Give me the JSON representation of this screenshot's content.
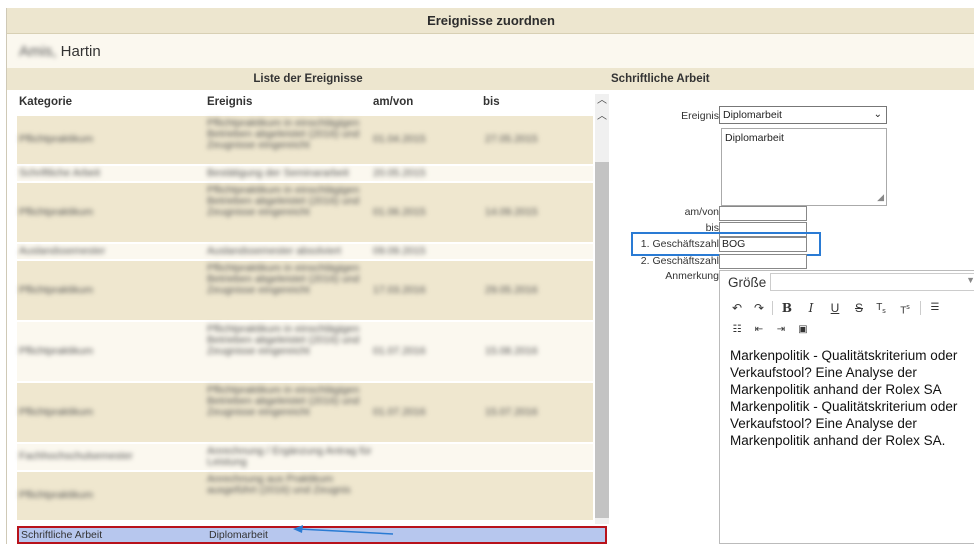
{
  "window": {
    "title": "Ereignisse zuordnen"
  },
  "person": {
    "name_blurred": "Amis, ",
    "name_visible": "Hartin"
  },
  "left_panel": {
    "title": "Liste der Ereignisse",
    "columns": [
      "Kategorie",
      "Ereignis",
      "am/von",
      "bis"
    ],
    "rows": [
      {
        "kategorie": "Pflichtpraktikum",
        "ereignis": "Pflichtpraktikum in einschlägigen Betrieben abgeleistet (2016) und Zeugnisse eingereicht",
        "von": "01.04.2015",
        "bis": "27.05.2015",
        "lines": 4,
        "style": "bg"
      },
      {
        "kategorie": "Schriftliche Arbeit",
        "ereignis": "Bestätigung der Seminararbeit",
        "von": "20.05.2015",
        "bis": "",
        "lines": 1,
        "style": "alt"
      },
      {
        "kategorie": "Pflichtpraktikum",
        "ereignis": "Pflichtpraktikum in einschlägigen Betrieben abgeleistet (2016) und Zeugnisse eingereicht",
        "von": "01.06.2015",
        "bis": "14.09.2015",
        "lines": 5,
        "style": "bg"
      },
      {
        "kategorie": "Auslandssemester",
        "ereignis": "Auslandssemester absolviert",
        "von": "09.09.2015",
        "bis": "",
        "lines": 1,
        "style": "alt"
      },
      {
        "kategorie": "Pflichtpraktikum",
        "ereignis": "Pflichtpraktikum in einschlägigen Betrieben abgeleistet (2016) und Zeugnisse eingereicht",
        "von": "17.03.2016",
        "bis": "29.05.2016",
        "lines": 5,
        "style": "bg"
      },
      {
        "kategorie": "Pflichtpraktikum",
        "ereignis": "Pflichtpraktikum in einschlägigen Betrieben abgeleistet (2016) und Zeugnisse eingereicht",
        "von": "01.07.2016",
        "bis": "15.08.2016",
        "lines": 5,
        "style": "alt"
      },
      {
        "kategorie": "Pflichtpraktikum",
        "ereignis": "Pflichtpraktikum in einschlägigen Betrieben abgeleistet (2016) und Zeugnisse eingereicht",
        "von": "01.07.2016",
        "bis": "15.07.2016",
        "lines": 5,
        "style": "bg"
      },
      {
        "kategorie": "Fachhochschulsemester",
        "ereignis": "Anrechnung / Ergänzung Antrag für Leistung",
        "von": "",
        "bis": "",
        "lines": 2,
        "style": "alt"
      },
      {
        "kategorie": "Pflichtpraktikum",
        "ereignis": "Anrechnung aus Praktikum ausgeführt (2016) und Zeugnis",
        "von": "",
        "bis": "",
        "lines": 4,
        "style": "bg"
      }
    ],
    "selected_row": {
      "kategorie": "Schriftliche Arbeit",
      "ereignis": "Diplomarbeit"
    }
  },
  "right_panel": {
    "title": "Schriftliche Arbeit",
    "labels": {
      "ereignis": "Ereignis",
      "am_von": "am/von",
      "bis": "bis",
      "gz1": "1. Geschäftszahl",
      "gz2": "2. Geschäftszahl",
      "anmerkung": "Anmerkung"
    },
    "ereignis_select": "Diplomarbeit",
    "ereignis_text": "Diplomarbeit",
    "am_von_value": "",
    "bis_value": "",
    "gz1_value": "BOG",
    "gz2_value": "",
    "editor": {
      "font_size_label": "Größe",
      "content": "Markenpolitik - Qualitätskriterium oder Verkaufstool? Eine Analyse der Markenpolitik anhand der Rolex SA Markenpolitik - Qualitätskriterium oder Verkaufstool? Eine Analyse der Markenpolitik anhand der Rolex SA."
    }
  },
  "colors": {
    "header_bg": "#ede6cf",
    "row_bg": "#efe7cf",
    "selected_bg": "#b7c7ee",
    "selected_border": "#b8121b",
    "highlight_blue": "#2a7bd4"
  }
}
